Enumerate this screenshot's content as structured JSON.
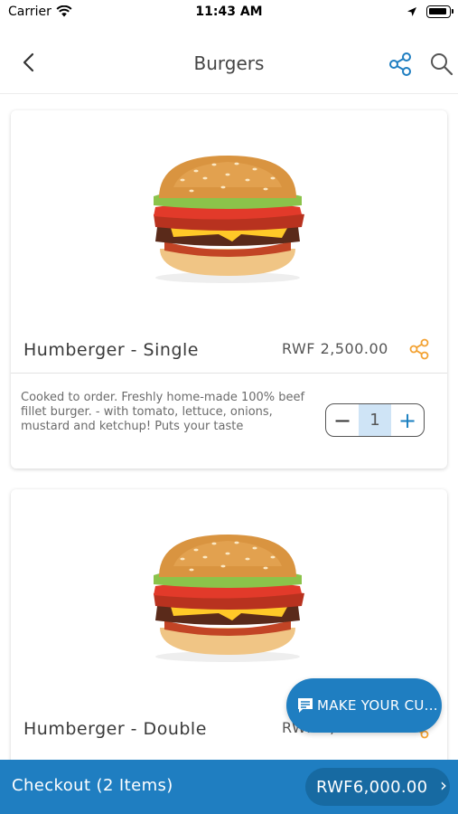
{
  "status_bar": {
    "carrier": "Carrier",
    "time": "11:43 AM"
  },
  "navbar": {
    "title": "Burgers",
    "back_icon": "chevron-left-icon",
    "share_icon": "share-icon",
    "search_icon": "search-icon"
  },
  "products": [
    {
      "name": "Humberger - Single",
      "price": "RWF 2,500.00",
      "description": "Cooked to order. Freshly home-made 100% beef fillet burger. - with tomato, lettuce, onions, mustard and ketchup! Puts your taste",
      "quantity": "1"
    },
    {
      "name": "Humberger - Double",
      "price": "RWF 3,500.00"
    }
  ],
  "stepper": {
    "minus": "−",
    "plus": "+"
  },
  "chat": {
    "label": "MAKE YOUR CU..."
  },
  "checkout": {
    "label": "Checkout (2 Items)",
    "total": "RWF6,000.00",
    "chevron": "›"
  },
  "colors": {
    "primary": "#1f7ec1",
    "primary_dark": "#176aa2",
    "accent_orange": "#f3a233",
    "stepper_highlight": "#cfe4f6"
  }
}
